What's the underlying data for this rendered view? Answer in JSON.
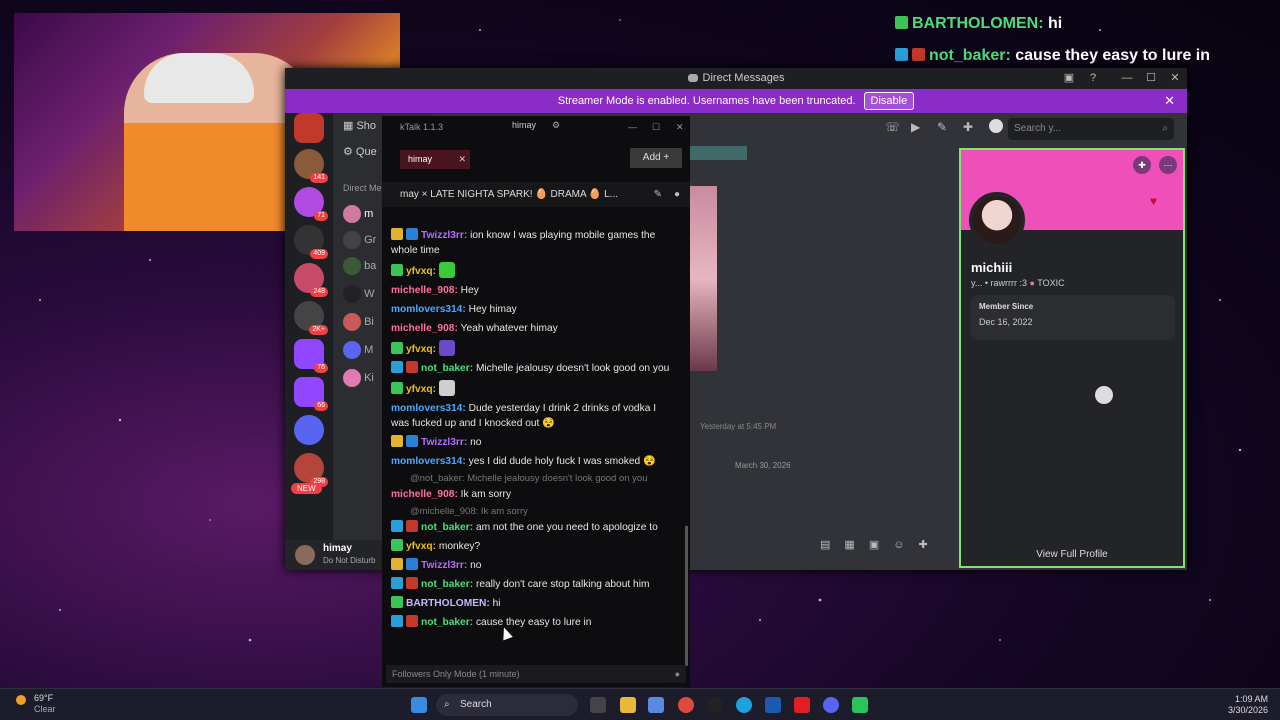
{
  "overlay_chat": [
    {
      "user": "BARTHOLOMEN",
      "sep": ": ",
      "text": "hi"
    },
    {
      "user": "not_baker",
      "sep": ": ",
      "text": "cause they easy to lure in"
    }
  ],
  "discord": {
    "window_title": "Direct Messages",
    "streamer_banner": "Streamer Mode is enabled. Usernames have been truncated.",
    "disable_button": "Disable",
    "search_placeholder": "Search y...",
    "channels": [
      "Sho",
      "Que",
      "Direct Me",
      "m",
      "Gr",
      "ba",
      "W",
      "Bi",
      "M",
      "Ki"
    ],
    "guild_counts": [
      "141",
      "71",
      "409",
      "248",
      "2K+",
      "76",
      "66",
      "298"
    ],
    "new_badge": "NEW",
    "user_name": "himay",
    "user_status": "Do Not Disturb",
    "date_divider": "March 30, 2026",
    "msg_timestamp": "Yesterday at 5:45 PM",
    "profile": {
      "name": "michiii",
      "subtitle": "y... • rawrrrr :3",
      "tag": "TOXIC",
      "member_since_label": "Member Since",
      "member_since_value": "Dec 16, 2022",
      "view_full_profile": "View Full Profile"
    }
  },
  "chatterino": {
    "title": "kTalk 1.1.3",
    "account": "himay",
    "tab": "himay",
    "add_label": "Add",
    "channel_header": "may ×   LATE NIGHTA SPARK! 🥚 DRAMA 🥚 L...",
    "input_placeholder": "Followers Only Mode (1 minute)",
    "messages": [
      {
        "user": "Twizzl3rr",
        "color": "#b36bff",
        "badges": [
          "gold",
          "blue"
        ],
        "text": "ion know I was playing mobile games the whole time",
        "wrap": true
      },
      {
        "user": "yfvxq",
        "color": "#e8c11b",
        "badges": [
          "green"
        ],
        "text": "",
        "emote": "#3aca3a"
      },
      {
        "user": "michelle_908",
        "color": "#ff6fa0",
        "badges": [],
        "text": "Hey"
      },
      {
        "user": "momlovers314",
        "color": "#4aa8ff",
        "badges": [],
        "text": "Hey himay"
      },
      {
        "user": "michelle_908",
        "color": "#ff6fa0",
        "badges": [],
        "text": "Yeah whatever himay"
      },
      {
        "user": "yfvxq",
        "color": "#e8c11b",
        "badges": [
          "green"
        ],
        "text": "",
        "emote": "#6a4ac8"
      },
      {
        "user": "not_baker",
        "color": "#4ade7b",
        "badges": [
          "cyan",
          "red"
        ],
        "text": "Michelle jealousy doesn't look good on you"
      },
      {
        "user": "yfvxq",
        "color": "#e8c11b",
        "badges": [
          "green"
        ],
        "text": "",
        "emote": "#cfcfcf"
      },
      {
        "user": "momlovers314",
        "color": "#4aa8ff",
        "badges": [],
        "text": "Dude yesterday I drink 2 drinks of vodka I was fucked up and I knocked out 😵",
        "wrap": true
      },
      {
        "user": "Twizzl3rr",
        "color": "#b36bff",
        "badges": [
          "gold",
          "blue"
        ],
        "text": "no"
      },
      {
        "user": "momlovers314",
        "color": "#4aa8ff",
        "badges": [],
        "text": "yes I did dude holy fuck I was smoked 😵"
      },
      {
        "reply": "@not_baker: Michelle jealousy doesn't look good on you"
      },
      {
        "user": "michelle_908",
        "color": "#ff6fa0",
        "badges": [],
        "text": "Ik am sorry"
      },
      {
        "reply": "@michelle_908: Ik am sorry"
      },
      {
        "user": "not_baker",
        "color": "#4ade7b",
        "badges": [
          "cyan",
          "red"
        ],
        "text": "am not the one you need to apologize to"
      },
      {
        "user": "yfvxq",
        "color": "#e8c11b",
        "badges": [
          "green"
        ],
        "text": "monkey?"
      },
      {
        "user": "Twizzl3rr",
        "color": "#b36bff",
        "badges": [
          "gold",
          "blue"
        ],
        "text": "no"
      },
      {
        "user": "not_baker",
        "color": "#4ade7b",
        "badges": [
          "cyan",
          "red"
        ],
        "text": "really don't care stop talking about him"
      },
      {
        "user": "BARTHOLOMEN",
        "color": "#c9b6ff",
        "badges": [
          "green"
        ],
        "text": "hi"
      },
      {
        "user": "not_baker",
        "color": "#4ade7b",
        "badges": [
          "cyan",
          "red"
        ],
        "text": "cause they easy to lure in"
      }
    ]
  },
  "taskbar": {
    "weather_temp": "69°F",
    "weather_desc": "Clear",
    "search_label": "Search",
    "time": "1:09 AM",
    "date": "3/30/2026"
  },
  "colors": {
    "streamer_banner": "#8b2cc7",
    "profile_banner": "#ee4fb8",
    "profile_border": "#7fe66b",
    "accent_green": "#4ade7b"
  }
}
